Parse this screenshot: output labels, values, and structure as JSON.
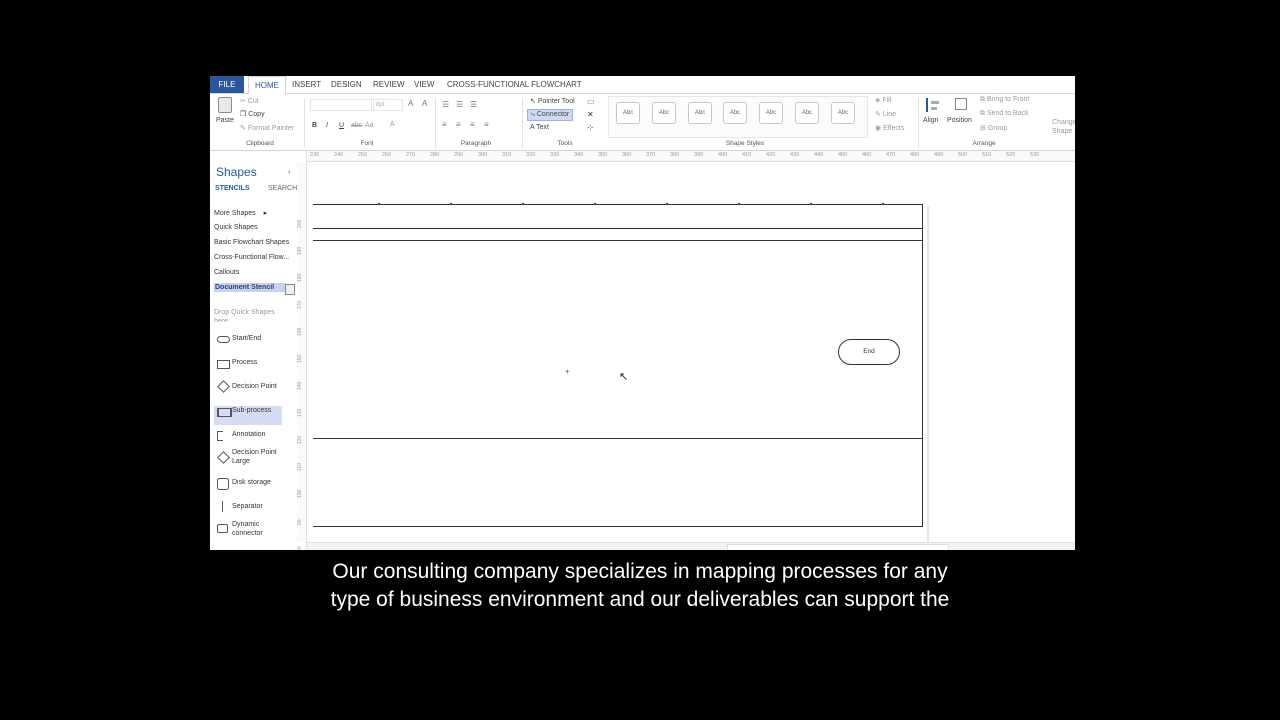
{
  "ribbon_tabs": [
    "FILE",
    "HOME",
    "INSERT",
    "DESIGN",
    "REVIEW",
    "VIEW",
    "CROSS-FUNCTIONAL FLOWCHART"
  ],
  "clipboard": {
    "paste": "Paste",
    "cut": "Cut",
    "copy": "Copy",
    "format_painter": "Format Painter",
    "label": "Clipboard"
  },
  "font": {
    "size": "8pt",
    "bold": "B",
    "italic": "I",
    "underline": "U",
    "strike": "abc",
    "case": "Aa",
    "color": "A",
    "label": "Font"
  },
  "paragraph": {
    "label": "Paragraph"
  },
  "tools": {
    "pointer": "Pointer Tool",
    "connector": "Connector",
    "text": "Text",
    "label": "Tools"
  },
  "shape_styles": {
    "samples": [
      "Abc",
      "Abc",
      "Abc",
      "Abc",
      "Abc",
      "Abc",
      "Abc"
    ],
    "label": "Shape Styles"
  },
  "style_opts": {
    "fill": "Fill",
    "line": "Line",
    "effects": "Effects"
  },
  "arrange": {
    "align": "Align",
    "position": "Position",
    "bring_front": "Bring to Front",
    "send_back": "Send to Back",
    "group": "Group",
    "label": "Arrange"
  },
  "change_shape": "Change Shape",
  "shapes_panel": {
    "title": "Shapes",
    "tab_stencils": "STENCILS",
    "tab_search": "SEARCH",
    "menu": [
      "More Shapes",
      "Quick Shapes",
      "Basic Flowchart Shapes",
      "Cross-Functional Flow...",
      "Callouts",
      "Document Stencil"
    ],
    "drop_hint": "Drop Quick Shapes here",
    "items": [
      "Start/End",
      "Process",
      "Decision Point",
      "Sub-process",
      "Annotation",
      "Decision Point Large",
      "Disk storage",
      "Separator",
      "Dynamic connector"
    ]
  },
  "ruler_top": [
    "230",
    "240",
    "250",
    "260",
    "270",
    "280",
    "290",
    "300",
    "310",
    "320",
    "330",
    "340",
    "350",
    "360",
    "370",
    "380",
    "390",
    "400",
    "410",
    "420",
    "430",
    "440",
    "450",
    "460",
    "470",
    "480",
    "490",
    "500",
    "510",
    "520",
    "530"
  ],
  "ruler_left": [
    "200",
    "190",
    "180",
    "170",
    "160",
    "150",
    "140",
    "130",
    "120",
    "110",
    "100",
    "90",
    "80"
  ],
  "canvas": {
    "end_label": "End"
  },
  "caption": {
    "line1": "Our consulting company specializes in mapping processes for any",
    "line2": "type of business environment and our deliverables can support the"
  }
}
